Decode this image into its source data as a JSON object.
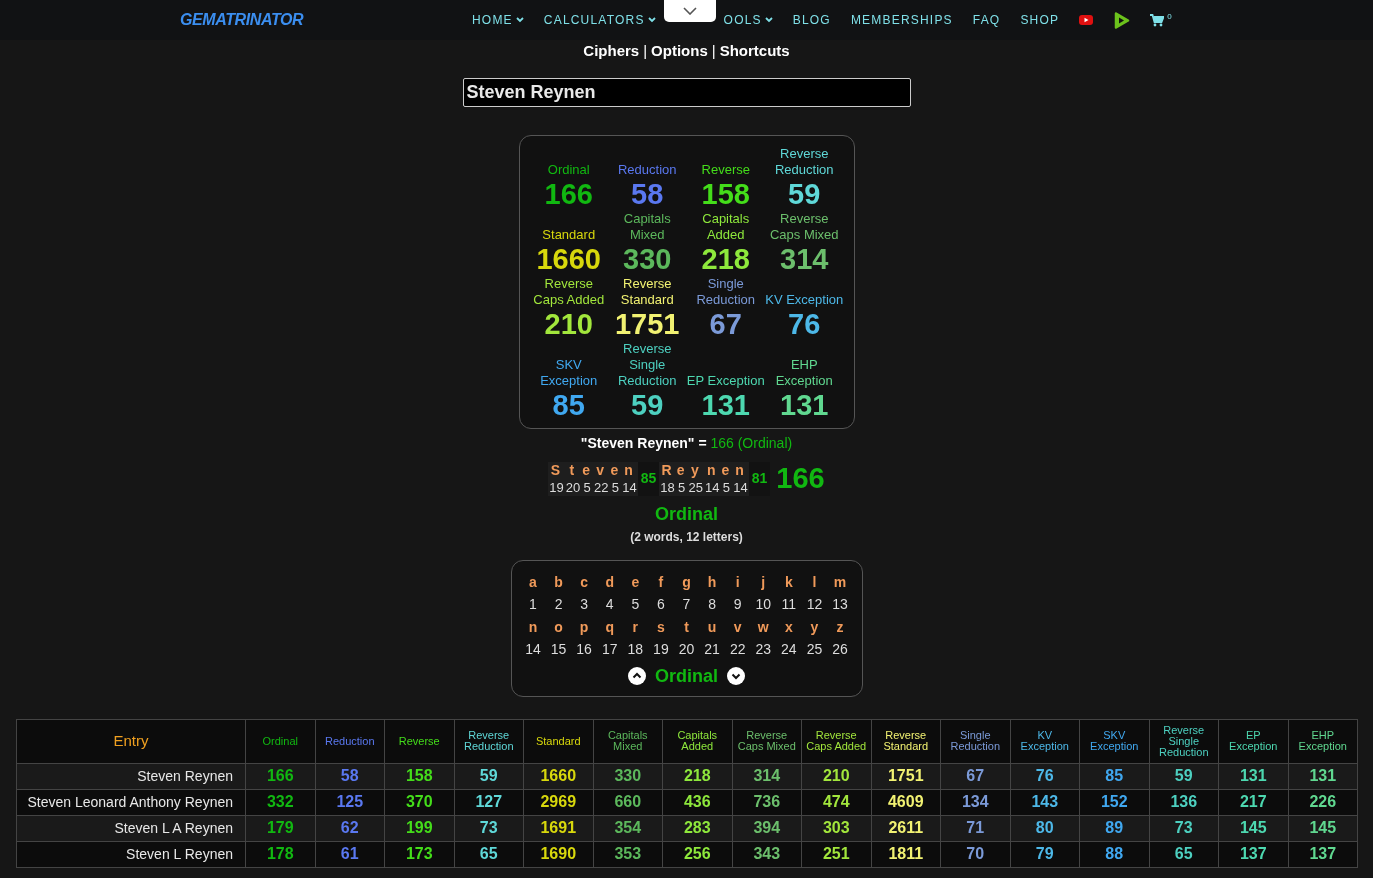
{
  "header": {
    "logo": "GEMATRINATOR",
    "nav": [
      {
        "label": "HOME",
        "dropdown": true
      },
      {
        "label": "CALCULATORS",
        "dropdown": true
      },
      {
        "label": "OOLS",
        "dropdown": true
      },
      {
        "label": "BLOG",
        "dropdown": false
      },
      {
        "label": "MEMBERSHIPS",
        "dropdown": false
      },
      {
        "label": "FAQ",
        "dropdown": false
      },
      {
        "label": "SHOP",
        "dropdown": false
      }
    ],
    "cart_count": "0"
  },
  "links": [
    "Ciphers",
    "Options",
    "Shortcuts"
  ],
  "link_separator": "|",
  "search": {
    "value": "Steven Reynen"
  },
  "ciphers": [
    {
      "name": "Ordinal",
      "value": "166",
      "color": "#11b811"
    },
    {
      "name": "Reduction",
      "value": "58",
      "color": "#5a78f0"
    },
    {
      "name": "Reverse",
      "value": "158",
      "color": "#44dd1a"
    },
    {
      "name": "Reverse Reduction",
      "value": "59",
      "color": "#5fd8d8"
    },
    {
      "name": "Standard",
      "value": "1660",
      "color": "#d8d80c"
    },
    {
      "name": "Capitals Mixed",
      "value": "330",
      "color": "#5cb85c"
    },
    {
      "name": "Capitals Added",
      "value": "218",
      "color": "#8ee83c"
    },
    {
      "name": "Reverse Caps Mixed",
      "value": "314",
      "color": "#6cbf6c"
    },
    {
      "name": "Reverse Caps Added",
      "value": "210",
      "color": "#a2e63c"
    },
    {
      "name": "Reverse Standard",
      "value": "1751",
      "color": "#f2f272"
    },
    {
      "name": "Single Reduction",
      "value": "67",
      "color": "#7b9ad8"
    },
    {
      "name": "KV Exception",
      "value": "76",
      "color": "#4db8e8"
    },
    {
      "name": "SKV Exception",
      "value": "85",
      "color": "#40a8f0"
    },
    {
      "name": "Reverse Single Reduction",
      "value": "59",
      "color": "#4dd0c0"
    },
    {
      "name": "EP Exception",
      "value": "131",
      "color": "#4dd8b0"
    },
    {
      "name": "EHP Exception",
      "value": "131",
      "color": "#60d890"
    }
  ],
  "breakdown": {
    "phrase": "\"Steven Reynen\" =",
    "result": "166 (Ordinal)",
    "words": [
      {
        "letters": [
          {
            "char": "S",
            "value": "19"
          },
          {
            "char": "t",
            "value": "20"
          },
          {
            "char": "e",
            "value": "5"
          },
          {
            "char": "v",
            "value": "22"
          },
          {
            "char": "e",
            "value": "5"
          },
          {
            "char": "n",
            "value": "14"
          }
        ],
        "total": "85"
      },
      {
        "letters": [
          {
            "char": "R",
            "value": "18"
          },
          {
            "char": "e",
            "value": "5"
          },
          {
            "char": "y",
            "value": "25"
          },
          {
            "char": "n",
            "value": "14"
          },
          {
            "char": "e",
            "value": "5"
          },
          {
            "char": "n",
            "value": "14"
          }
        ],
        "total": "81"
      }
    ],
    "total": "166",
    "cipher": "Ordinal",
    "summary": "(2 words, 12 letters)"
  },
  "chart": {
    "rows": [
      [
        {
          "char": "a",
          "value": "1"
        },
        {
          "char": "b",
          "value": "2"
        },
        {
          "char": "c",
          "value": "3"
        },
        {
          "char": "d",
          "value": "4"
        },
        {
          "char": "e",
          "value": "5"
        },
        {
          "char": "f",
          "value": "6"
        },
        {
          "char": "g",
          "value": "7"
        },
        {
          "char": "h",
          "value": "8"
        },
        {
          "char": "i",
          "value": "9"
        },
        {
          "char": "j",
          "value": "10"
        },
        {
          "char": "k",
          "value": "11"
        },
        {
          "char": "l",
          "value": "12"
        },
        {
          "char": "m",
          "value": "13"
        }
      ],
      [
        {
          "char": "n",
          "value": "14"
        },
        {
          "char": "o",
          "value": "15"
        },
        {
          "char": "p",
          "value": "16"
        },
        {
          "char": "q",
          "value": "17"
        },
        {
          "char": "r",
          "value": "18"
        },
        {
          "char": "s",
          "value": "19"
        },
        {
          "char": "t",
          "value": "20"
        },
        {
          "char": "u",
          "value": "21"
        },
        {
          "char": "v",
          "value": "22"
        },
        {
          "char": "w",
          "value": "23"
        },
        {
          "char": "x",
          "value": "24"
        },
        {
          "char": "y",
          "value": "25"
        },
        {
          "char": "z",
          "value": "26"
        }
      ]
    ],
    "cipher": "Ordinal"
  },
  "table": {
    "entry_header": "Entry",
    "columns": [
      {
        "label": "Ordinal",
        "color": "#11b811"
      },
      {
        "label": "Reduction",
        "color": "#5a78f0"
      },
      {
        "label": "Reverse",
        "color": "#44dd1a"
      },
      {
        "label": "Reverse Reduction",
        "color": "#5fd8d8"
      },
      {
        "label": "Standard",
        "color": "#d8d80c"
      },
      {
        "label": "Capitals Mixed",
        "color": "#5cb85c"
      },
      {
        "label": "Capitals Added",
        "color": "#8ee83c"
      },
      {
        "label": "Reverse Caps Mixed",
        "color": "#6cbf6c"
      },
      {
        "label": "Reverse Caps Added",
        "color": "#a2e63c"
      },
      {
        "label": "Reverse Standard",
        "color": "#f2f272"
      },
      {
        "label": "Single Reduction",
        "color": "#7b9ad8"
      },
      {
        "label": "KV Exception",
        "color": "#4db8e8"
      },
      {
        "label": "SKV Exception",
        "color": "#40a8f0"
      },
      {
        "label": "Reverse Single Reduction",
        "color": "#4dd0c0"
      },
      {
        "label": "EP Exception",
        "color": "#4dd8b0"
      },
      {
        "label": "EHP Exception",
        "color": "#60d890"
      }
    ],
    "rows": [
      {
        "entry": "Steven Reynen",
        "values": [
          "166",
          "58",
          "158",
          "59",
          "1660",
          "330",
          "218",
          "314",
          "210",
          "1751",
          "67",
          "76",
          "85",
          "59",
          "131",
          "131"
        ]
      },
      {
        "entry": "Steven Leonard Anthony Reynen",
        "values": [
          "332",
          "125",
          "370",
          "127",
          "2969",
          "660",
          "436",
          "736",
          "474",
          "4609",
          "134",
          "143",
          "152",
          "136",
          "217",
          "226"
        ]
      },
      {
        "entry": "Steven L A Reynen",
        "values": [
          "179",
          "62",
          "199",
          "73",
          "1691",
          "354",
          "283",
          "394",
          "303",
          "2611",
          "71",
          "80",
          "89",
          "73",
          "145",
          "145"
        ]
      },
      {
        "entry": "Steven L Reynen",
        "values": [
          "178",
          "61",
          "173",
          "65",
          "1690",
          "353",
          "256",
          "343",
          "251",
          "1811",
          "70",
          "79",
          "88",
          "65",
          "137",
          "137"
        ]
      }
    ]
  }
}
